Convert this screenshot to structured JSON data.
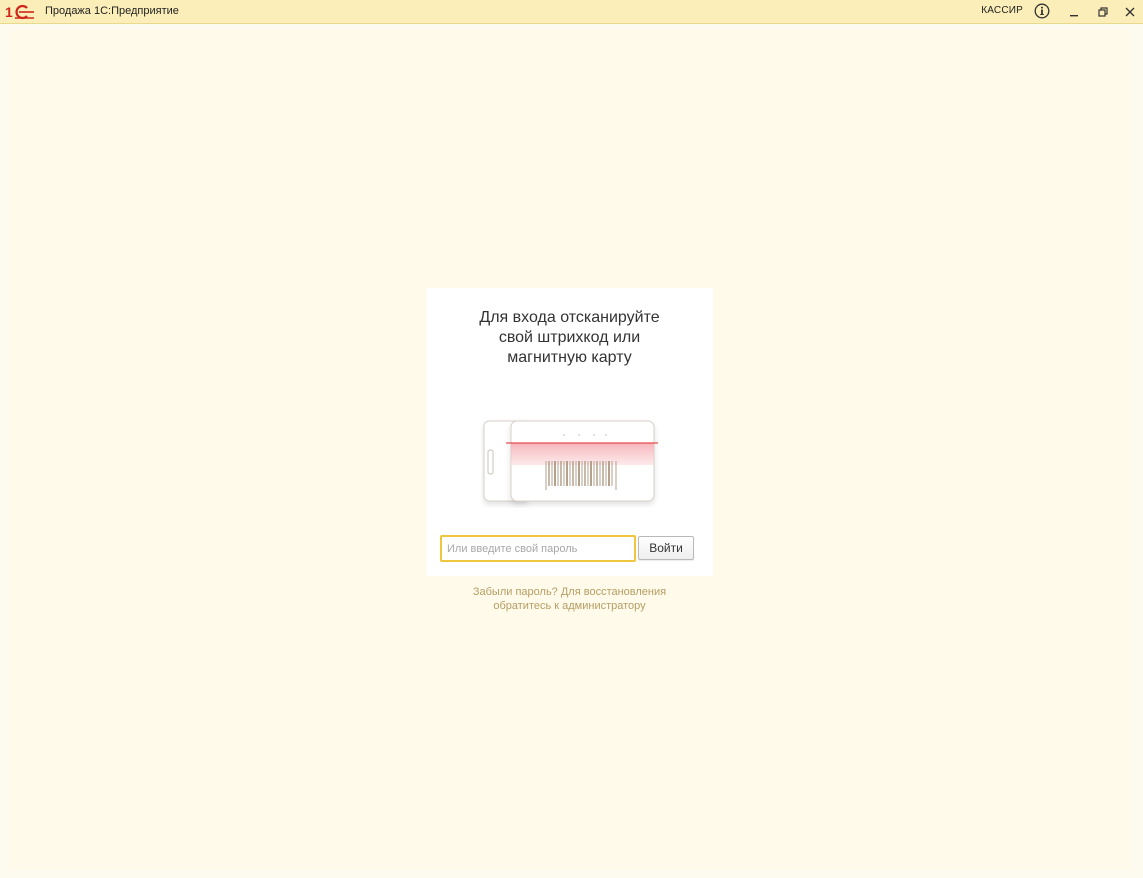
{
  "window": {
    "title": "Продажа 1С:Предприятие",
    "user": "КАССИР",
    "icons": {
      "logo": "1c-logo-icon",
      "info": "info-icon",
      "minimize": "minimize-icon",
      "restore": "restore-icon",
      "close": "close-icon"
    }
  },
  "colors": {
    "titlebar_bg": "#fbeeb8",
    "page_bg": "#fffaea",
    "accent": "#f0c63f",
    "link_text": "#b59e63",
    "logo_red": "#d0261c",
    "scan_line": "#e54d4d"
  },
  "login": {
    "headline_lines": [
      "Для входа отсканируйте",
      "свой штрихкод или",
      "магнитную карту"
    ],
    "illustration_icon": "barcode-card-scan-icon",
    "password_placeholder": "Или введите свой пароль",
    "password_value": "",
    "login_button": "Войти",
    "forgot_lines": [
      "Забыли пароль? Для восстановления",
      "обратитесь к администратору"
    ]
  }
}
